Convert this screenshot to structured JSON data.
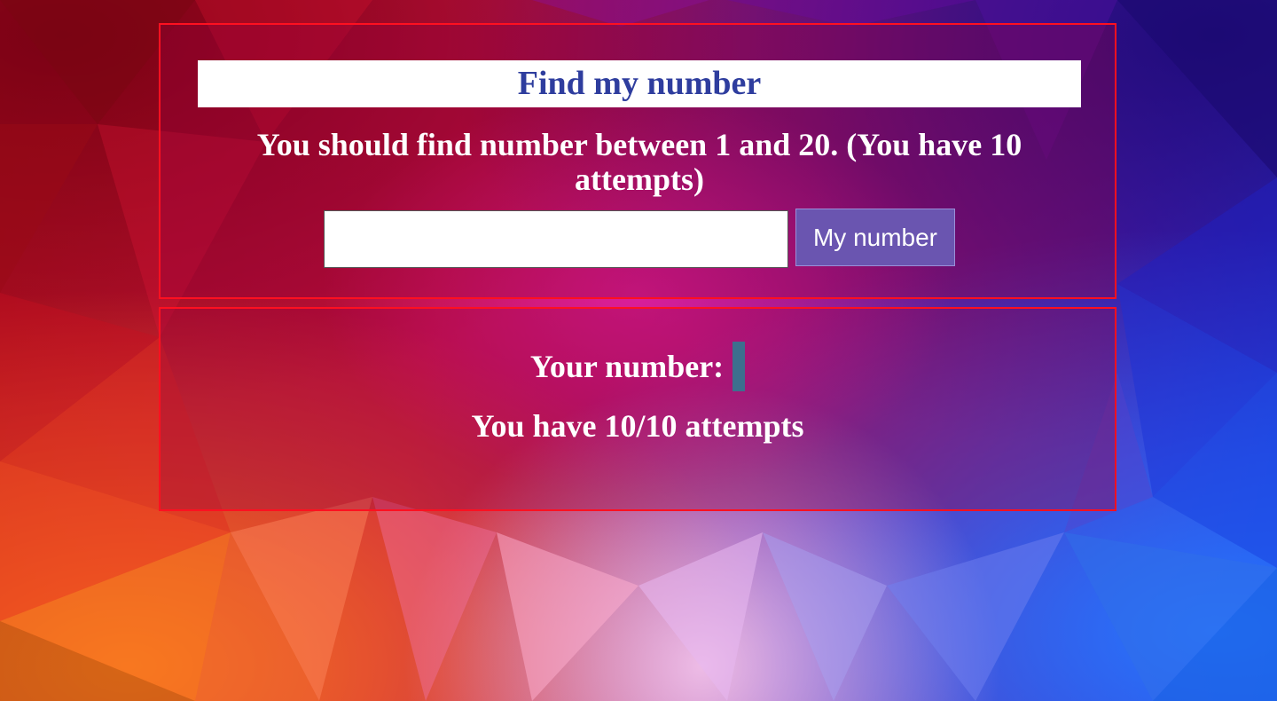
{
  "game": {
    "title": "Find my number",
    "instructions": "You should find number between 1 and 20. (You have 10 attempts)",
    "input_value": "",
    "submit_label": "My number"
  },
  "result": {
    "your_number_label": "Your number:",
    "your_number_value": "",
    "attempts_text": "You have 10/10 attempts"
  },
  "colors": {
    "panel_border": "#ff1020",
    "title_text": "#2e3d9e",
    "button_bg": "#6a55b0",
    "number_box": "#3d6f8e"
  }
}
